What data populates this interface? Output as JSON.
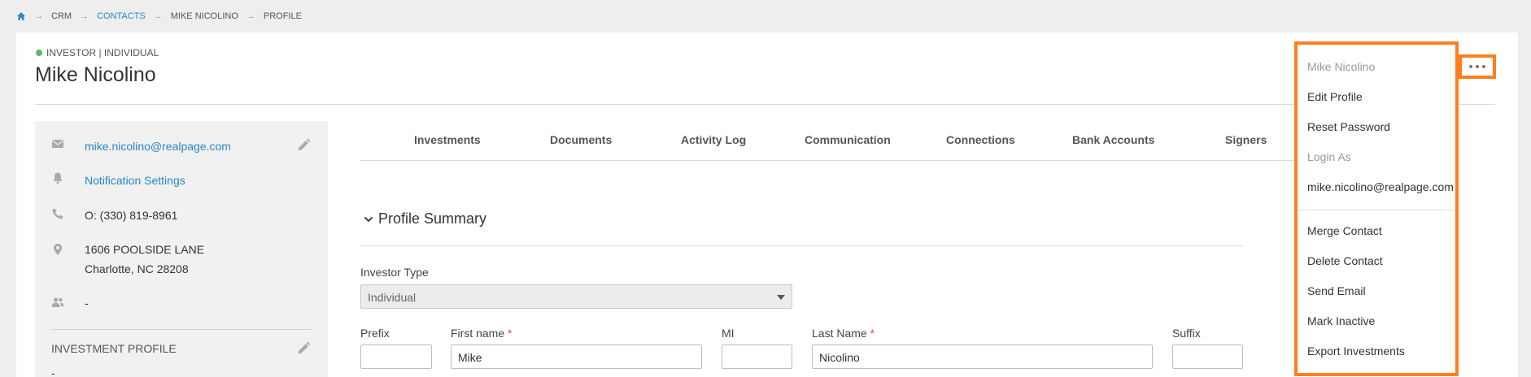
{
  "breadcrumb": {
    "items": [
      {
        "label": "CRM",
        "link": false
      },
      {
        "label": "CONTACTS",
        "link": true
      },
      {
        "label": "MIKE NICOLINO",
        "link": false
      },
      {
        "label": "PROFILE",
        "link": false
      }
    ]
  },
  "header": {
    "status": "INVESTOR | INDIVIDUAL",
    "status_color": "#5cb85c",
    "name": "Mike Nicolino"
  },
  "sidebar": {
    "email": "mike.nicolino@realpage.com",
    "notification": "Notification Settings",
    "phone": "O: (330) 819-8961",
    "address_line1": "1606 POOLSIDE LANE",
    "address_line2": "Charlotte, NC 28208",
    "contact_dash": "-",
    "section_title": "INVESTMENT PROFILE",
    "section_value": "-"
  },
  "tabs": [
    "Investments",
    "Documents",
    "Activity Log",
    "Communication",
    "Connections",
    "Bank Accounts",
    "Signers"
  ],
  "profile_summary": {
    "title": "Profile Summary",
    "investor_type_label": "Investor Type",
    "investor_type_value": "Individual",
    "prefix_label": "Prefix",
    "prefix_value": "",
    "first_name_label": "First name",
    "first_name_value": "Mike",
    "mi_label": "MI",
    "mi_value": "",
    "last_name_label": "Last Name",
    "last_name_value": "Nicolino",
    "suffix_label": "Suffix",
    "suffix_value": "",
    "required_mark": "*"
  },
  "menu": {
    "header": "Mike Nicolino",
    "items": [
      {
        "label": "Edit Profile",
        "disabled": false
      },
      {
        "label": "Reset Password",
        "disabled": false
      },
      {
        "label": "Login As",
        "disabled": true
      },
      {
        "label": "mike.nicolino@realpage.com",
        "disabled": false
      },
      {
        "label": "Merge Contact",
        "disabled": false
      },
      {
        "label": "Delete Contact",
        "disabled": false
      },
      {
        "label": "Send Email",
        "disabled": false
      },
      {
        "label": "Mark Inactive",
        "disabled": false
      },
      {
        "label": "Export Investments",
        "disabled": false
      }
    ]
  },
  "colors": {
    "accent": "#2a86c8",
    "highlight": "#ff7f1e",
    "required": "#d9534f"
  }
}
